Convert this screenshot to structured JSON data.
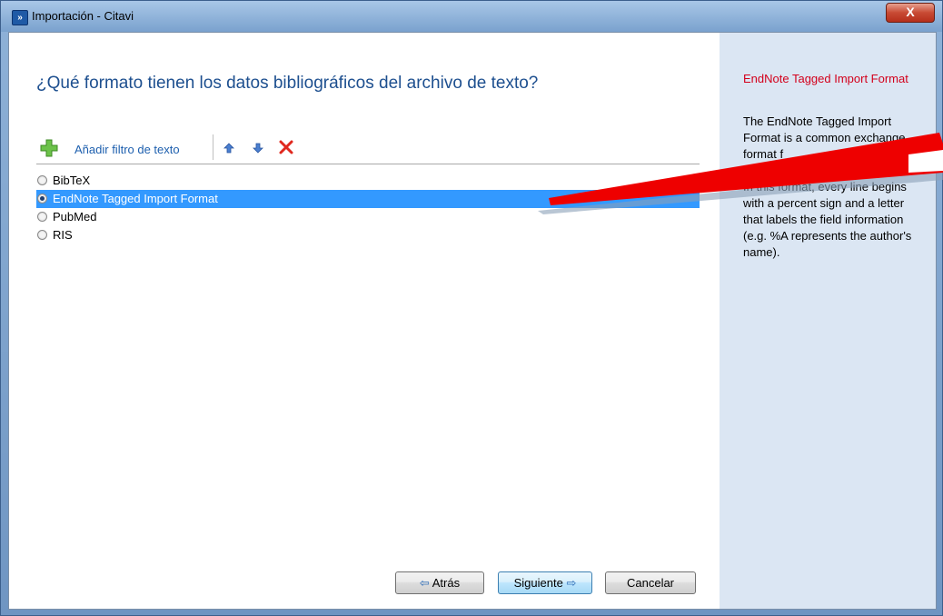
{
  "window": {
    "title": "Importación - Citavi",
    "close_glyph": "X",
    "app_icon_glyph": "»"
  },
  "main": {
    "question": "¿Qué formato tienen los datos bibliográficos del archivo de texto?",
    "toolbar": {
      "add_filter_label": "Añadir filtro de texto"
    },
    "formats": [
      {
        "label": "BibTeX",
        "selected": false
      },
      {
        "label": "EndNote Tagged Import Format",
        "selected": true
      },
      {
        "label": "PubMed",
        "selected": false
      },
      {
        "label": "RIS",
        "selected": false
      }
    ]
  },
  "sidebar": {
    "title": "EndNote Tagged Import Format",
    "paragraph1": "The EndNote Tagged Import Format is a common exchange format f",
    "paragraph2": "In this format, every line begins with a percent sign and a letter that labels the field information (e.g. %A represents the author's name)."
  },
  "buttons": {
    "back_label": "Atrás",
    "next_label": "Siguiente",
    "cancel_label": "Cancelar",
    "back_arrow": "⇦",
    "next_arrow": "⇨"
  },
  "colors": {
    "selection": "#3399ff",
    "question_text": "#1d4f8f",
    "sidebar_title": "#d3001b",
    "sidebar_bg": "#dbe6f3",
    "annotation_arrow": "#ee0000"
  }
}
